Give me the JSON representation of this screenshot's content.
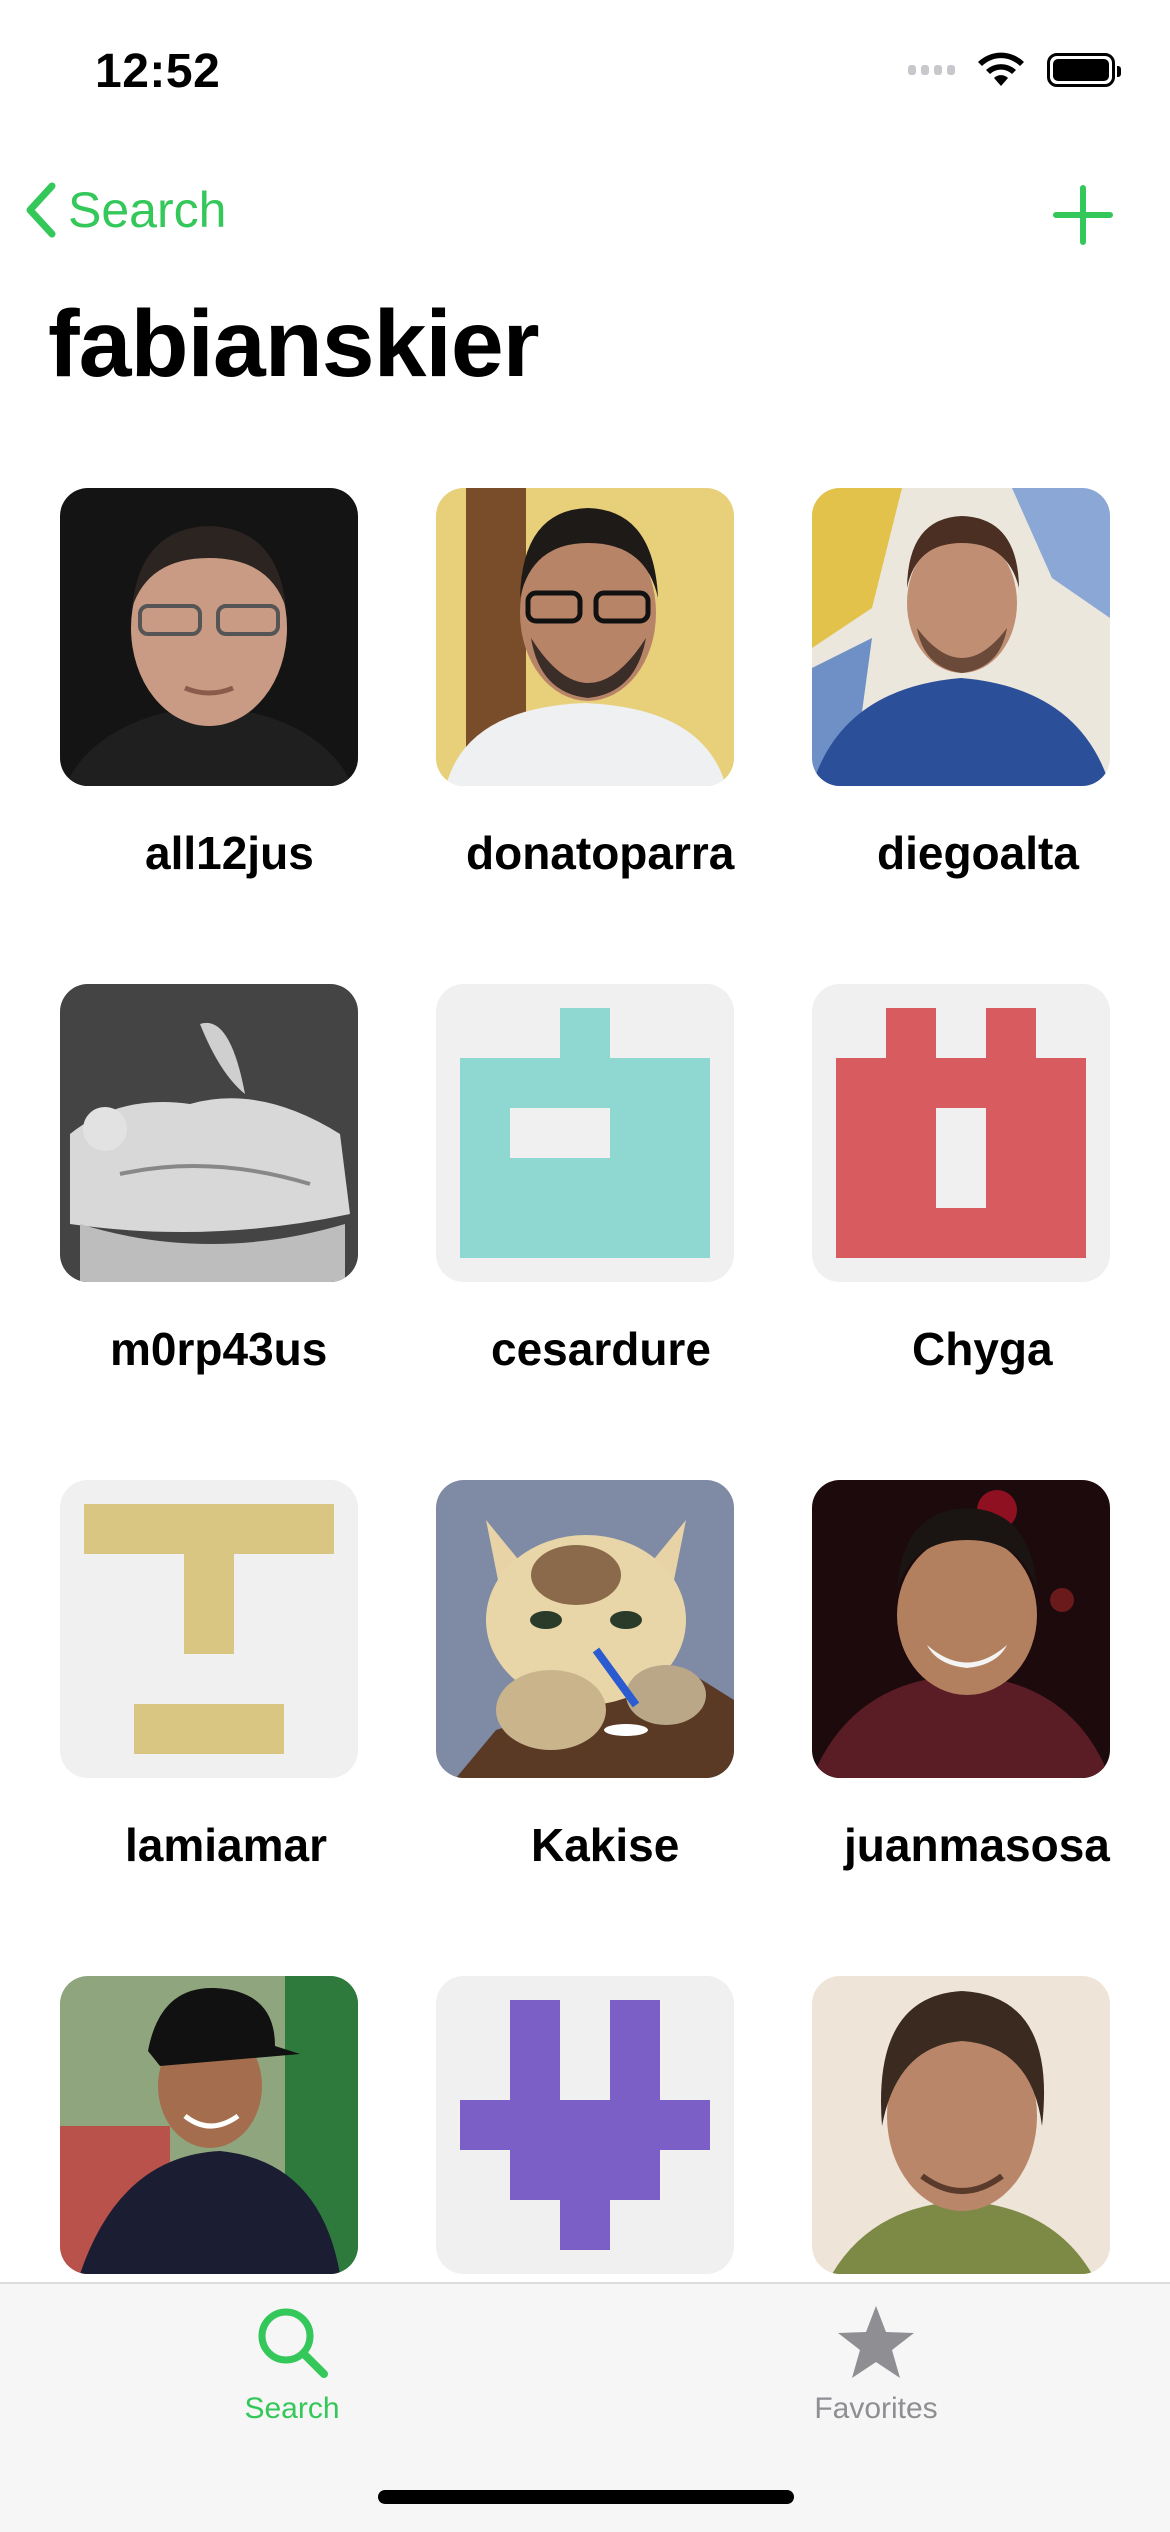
{
  "status_bar": {
    "time": "12:52"
  },
  "nav": {
    "back_label": "Search",
    "title": "fabianskier"
  },
  "colors": {
    "accent": "#34c759",
    "inactive": "#8e8e93",
    "tile_bg": "#f0f0f0"
  },
  "users": [
    {
      "name": "all12jus",
      "avatar": "photo"
    },
    {
      "name": "donatoparra",
      "avatar": "photo"
    },
    {
      "name": "diegoalta",
      "avatar": "photo"
    },
    {
      "name": "m0rp43us",
      "avatar": "photo"
    },
    {
      "name": "cesardure",
      "avatar": "identicon",
      "color": "#8fd8d2"
    },
    {
      "name": "Chyga",
      "avatar": "identicon",
      "color": "#d75b5f"
    },
    {
      "name": "lamiamar",
      "avatar": "identicon",
      "color": "#d8c682"
    },
    {
      "name": "Kakise",
      "avatar": "illustration"
    },
    {
      "name": "juanmasosa",
      "avatar": "photo"
    },
    {
      "name": "",
      "avatar": "photo"
    },
    {
      "name": "",
      "avatar": "identicon",
      "color": "#7b5fc7"
    },
    {
      "name": "",
      "avatar": "photo"
    }
  ],
  "tabbar": {
    "search_label": "Search",
    "favorites_label": "Favorites"
  }
}
